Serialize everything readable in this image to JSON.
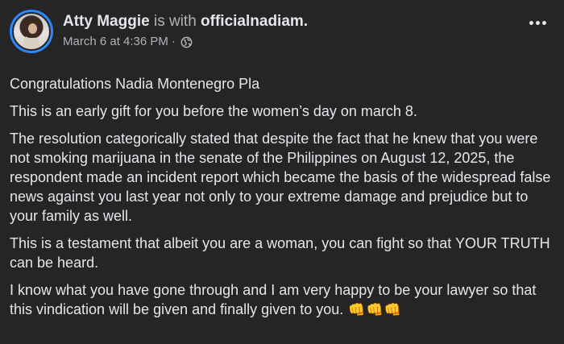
{
  "header": {
    "author": "Atty Maggie",
    "with_text": "is with",
    "tagged": "officialnadiam.",
    "timestamp": "March 6 at 4:36 PM",
    "separator": "·",
    "privacy_icon": "globe-icon",
    "more_icon": "more-horizontal-icon"
  },
  "post": {
    "paragraphs": [
      "Congratulations Nadia Montenegro Pla",
      "This is an early gift for you before the women’s day on march 8.",
      "The resolution categorically stated that despite the fact that he knew that you were not smoking marijuana in the senate of the Philippines on August 12, 2025, the respondent made an incident report which became the basis of the widespread false news against you last year not only to your extreme damage and prejudice but to your family as well.",
      "This is a testament that albeit you are a woman, you can fight so that  YOUR TRUTH can be heard.",
      "I know what you have gone through and I am very happy to be your lawyer so that this vindication will be given and finally given to you."
    ],
    "emoji": [
      "👊",
      "👊",
      "👊"
    ]
  },
  "colors": {
    "background": "#252526",
    "primary_text": "#e4e6eb",
    "secondary_text": "#b0b3b8",
    "avatar_ring": "#2d88ff"
  }
}
